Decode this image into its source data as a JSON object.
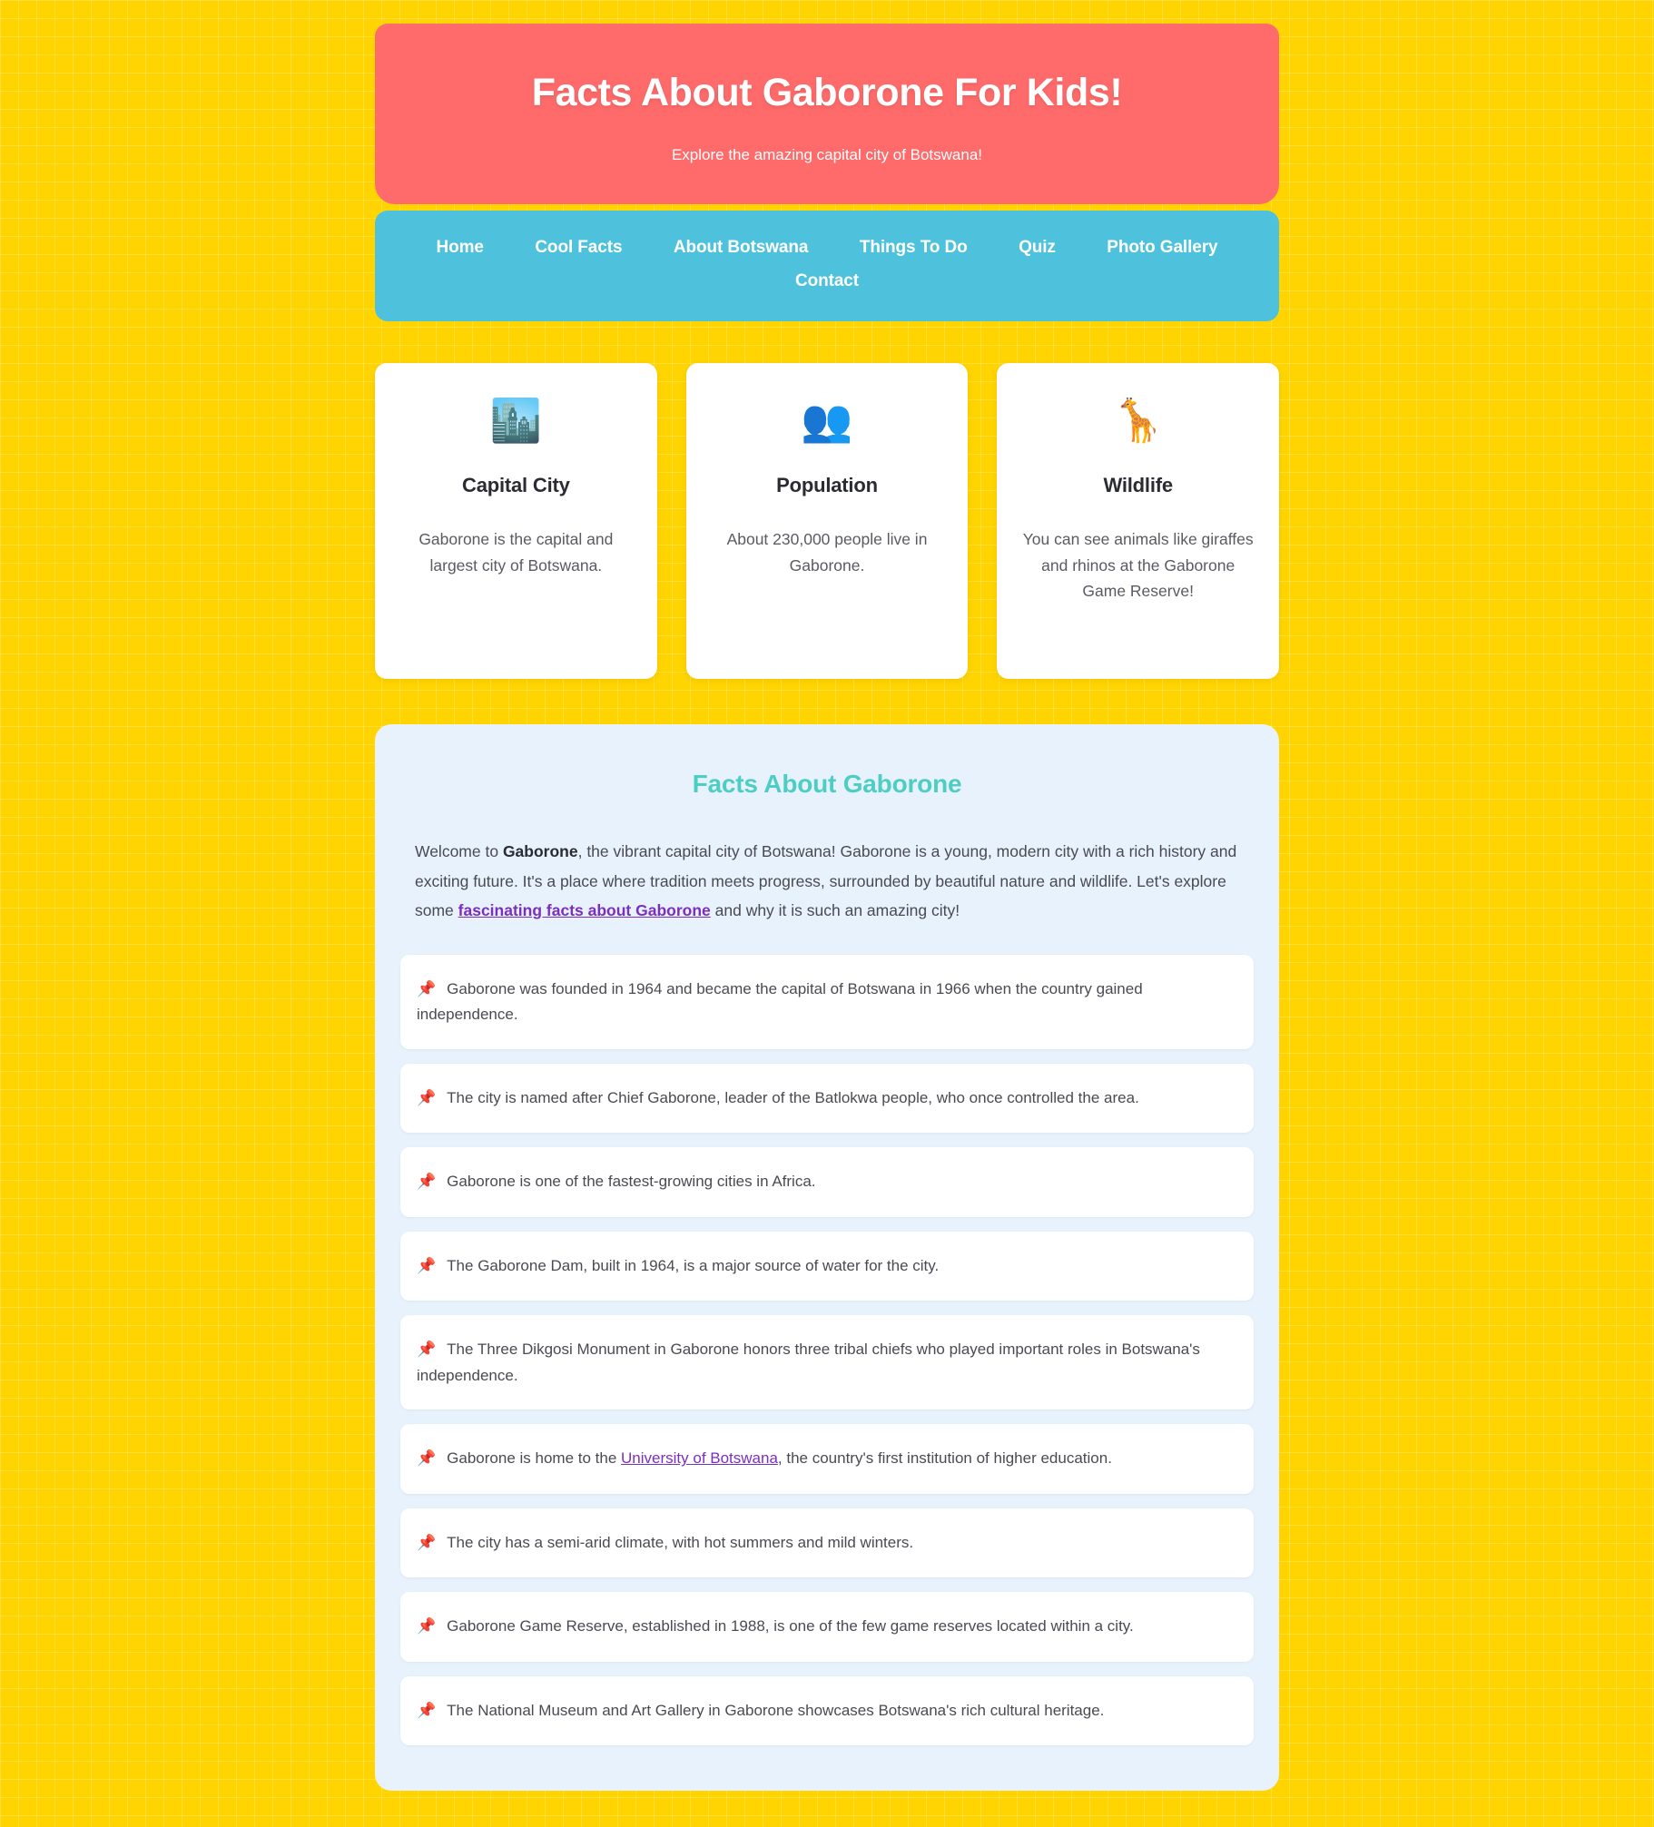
{
  "theme": {
    "background": "#FFD400",
    "header_bg": "#FF6B6B",
    "nav_bg": "#4EC2DC",
    "facts_bg": "#E7F2FC",
    "accent_teal": "#4ECDC4",
    "link_purple": "#7B2FBE",
    "pin_red": "#E03A3A",
    "card_bg": "#FFFFFF"
  },
  "header": {
    "title": "Facts About Gaborone For Kids!",
    "subtitle": "Explore the amazing capital city of Botswana!"
  },
  "nav": {
    "items": [
      {
        "label": "Home"
      },
      {
        "label": "Cool Facts"
      },
      {
        "label": "About Botswana"
      },
      {
        "label": "Things To Do"
      },
      {
        "label": "Quiz"
      },
      {
        "label": "Photo Gallery"
      },
      {
        "label": "Contact"
      }
    ]
  },
  "cards": [
    {
      "icon": "🏙️",
      "icon_name": "cityscape-icon",
      "title": "Capital City",
      "text": "Gaborone is the capital and largest city of Botswana."
    },
    {
      "icon": "👥",
      "icon_name": "busts-in-silhouette-icon",
      "title": "Population",
      "text": "About 230,000 people live in Gaborone."
    },
    {
      "icon": "🦒",
      "icon_name": "giraffe-icon",
      "title": "Wildlife",
      "text": "You can see animals like giraffes and rhinos at the Gaborone Game Reserve!"
    }
  ],
  "facts_section": {
    "heading": "Facts About Gaborone",
    "intro": {
      "part1": "Welcome to ",
      "bold1": "Gaborone",
      "part2": ", the vibrant capital city of Botswana! Gaborone is a young, modern city with a rich history and exciting future. It's a place where tradition meets progress, surrounded by beautiful nature and wildlife. Let's explore some ",
      "link": "fascinating facts about Gaborone",
      "part3": " and why it is such an amazing city!"
    },
    "pin_icon": "📌",
    "facts": [
      {
        "text": "Gaborone was founded in 1964 and became the capital of Botswana in 1966 when the country gained independence."
      },
      {
        "text": "The city is named after Chief Gaborone, leader of the Batlokwa people, who once controlled the area."
      },
      {
        "text": "Gaborone is one of the fastest-growing cities in Africa."
      },
      {
        "text": "The Gaborone Dam, built in 1964, is a major source of water for the city."
      },
      {
        "text": "The Three Dikgosi Monument in Gaborone honors three tribal chiefs who played important roles in Botswana's independence."
      },
      {
        "pre": "Gaborone is home to the ",
        "link": "University of Botswana",
        "post": ", the country's first institution of higher education."
      },
      {
        "text": "The city has a semi-arid climate, with hot summers and mild winters."
      },
      {
        "text": "Gaborone Game Reserve, established in 1988, is one of the few game reserves located within a city."
      },
      {
        "text": "The National Museum and Art Gallery in Gaborone showcases Botswana's rich cultural heritage."
      }
    ]
  }
}
